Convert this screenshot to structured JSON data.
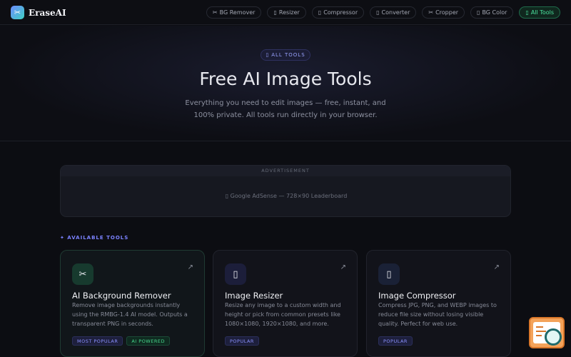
{
  "header": {
    "logo_icon": "scissors-icon",
    "logo_text": "EraseAI",
    "nav": [
      {
        "icon": "✂",
        "label": "BG Remover"
      },
      {
        "icon": "▯",
        "label": "Resizer"
      },
      {
        "icon": "▯",
        "label": "Compressor"
      },
      {
        "icon": "▯",
        "label": "Converter"
      },
      {
        "icon": "✂",
        "label": "Cropper"
      },
      {
        "icon": "▯",
        "label": "BG Color"
      },
      {
        "icon": "▯",
        "label": "All Tools"
      }
    ]
  },
  "hero": {
    "badge_icon": "▯",
    "badge": "ALL TOOLS",
    "title": "Free AI Image Tools",
    "subtitle": "Everything you need to edit images — free, instant, and 100% private. All tools run directly in your browser."
  },
  "ad": {
    "label": "ADVERTISEMENT",
    "slot": "▯ Google AdSense — 728×90 Leaderboard"
  },
  "section_label": "✦ AVAILABLE TOOLS",
  "cards": [
    {
      "icon": "✂",
      "arrow": "↗",
      "title": "AI Background Remover",
      "desc": "Remove image backgrounds instantly using the RMBG-1.4 AI model. Outputs a transparent PNG in seconds.",
      "tags": [
        "MOST POPULAR",
        "AI POWERED"
      ]
    },
    {
      "icon": "▯",
      "arrow": "↗",
      "title": "Image Resizer",
      "desc": "Resize any image to a custom width and height or pick from common presets like 1080×1080, 1920×1080, and more.",
      "tags": [
        "POPULAR"
      ]
    },
    {
      "icon": "▯",
      "arrow": "↗",
      "title": "Image Compressor",
      "desc": "Compress JPG, PNG, and WEBP images to reduce file size without losing visible quality. Perfect for web use.",
      "tags": [
        "POPULAR"
      ]
    }
  ],
  "colors": {
    "accent": "#7b82ff",
    "active_green": "#4be39e",
    "background": "#0c0d12"
  }
}
